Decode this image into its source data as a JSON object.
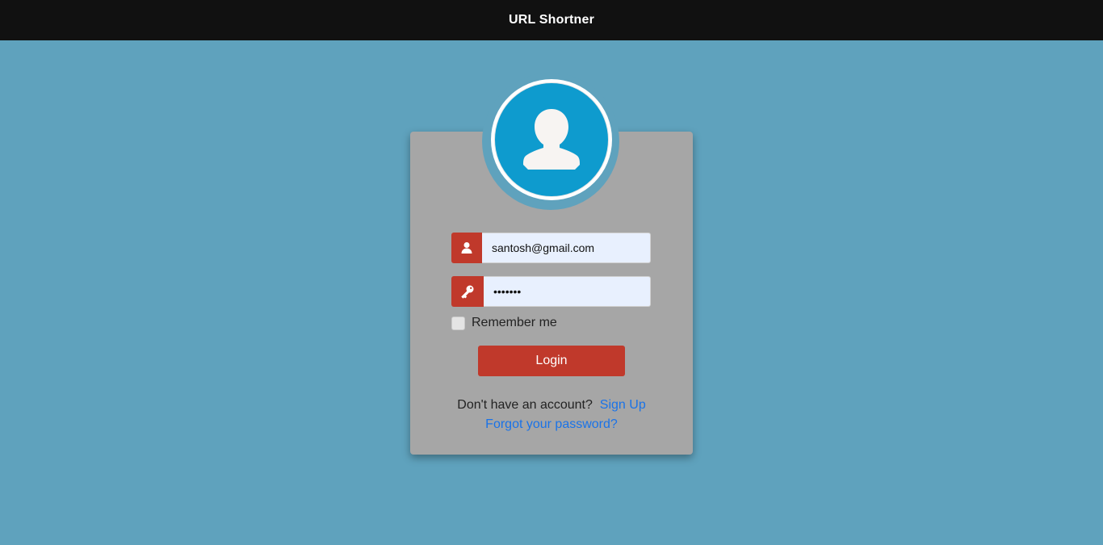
{
  "header": {
    "title": "URL Shortner"
  },
  "avatar": {
    "icon": "user-silhouette-icon",
    "color": "#0e9bce"
  },
  "form": {
    "email": {
      "icon": "user-icon",
      "value": "santosh@gmail.com"
    },
    "password": {
      "icon": "key-icon",
      "value": "•••••••"
    },
    "remember_label": "Remember me",
    "login_label": "Login",
    "signup_prompt": "Don't have an account?",
    "signup_link": "Sign Up",
    "forgot_link": "Forgot your password?"
  },
  "colors": {
    "background": "#5fa2bd",
    "header": "#111111",
    "card": "#a6a6a6",
    "accent": "#c0392b",
    "link": "#1a73e8"
  }
}
